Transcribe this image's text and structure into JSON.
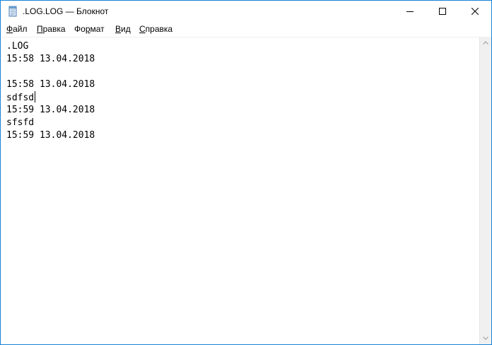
{
  "window": {
    "title": ".LOG.LOG — Блокнот",
    "icon": "notepad-icon",
    "accent_color": "#1883d7"
  },
  "caption_buttons": {
    "minimize_icon": "minimize-icon",
    "maximize_icon": "maximize-icon",
    "close_icon": "close-icon"
  },
  "menu": {
    "items": [
      {
        "mnemonic": "Ф",
        "rest": "айл"
      },
      {
        "mnemonic": "П",
        "rest": "равка"
      },
      {
        "mnemonic": "Ф",
        "rest": "о",
        "mnemonic2": "р",
        "rest2": "мат"
      },
      {
        "mnemonic": "В",
        "rest": "ид"
      },
      {
        "mnemonic": "С",
        "rest": "правка"
      }
    ]
  },
  "editor": {
    "lines": [
      ".LOG",
      "15:58 13.04.2018",
      "",
      "15:58 13.04.2018",
      "sdfsd",
      "15:59 13.04.2018",
      "sfsfd",
      "15:59 13.04.2018"
    ]
  },
  "scrollbar": {
    "up_icon": "scroll-up-arrow-icon",
    "down_icon": "scroll-down-arrow-icon"
  }
}
